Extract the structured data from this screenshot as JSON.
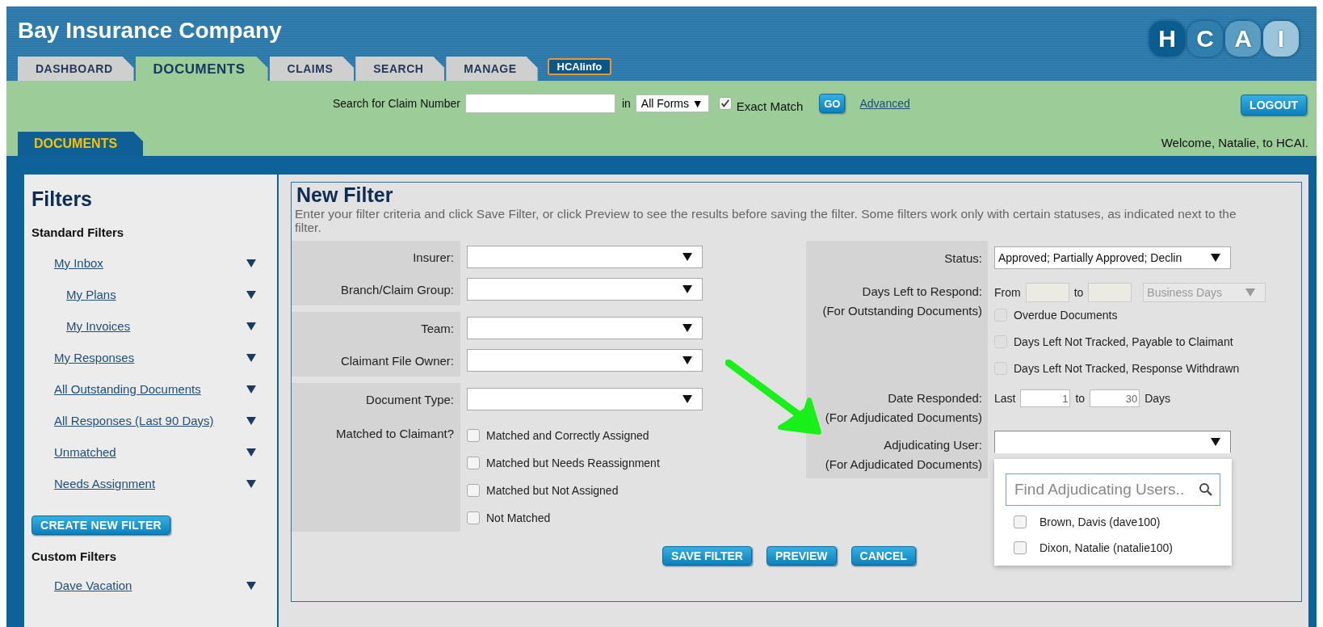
{
  "header": {
    "company": "Bay Insurance Company",
    "logo_letters": [
      "H",
      "C",
      "A",
      "I"
    ]
  },
  "tabs": [
    {
      "label": "DASHBOARD",
      "selected": false
    },
    {
      "label": "DOCUMENTS",
      "selected": true
    },
    {
      "label": "CLAIMS",
      "selected": false
    },
    {
      "label": "SEARCH",
      "selected": false
    },
    {
      "label": "MANAGE",
      "selected": false
    }
  ],
  "info_button": "HCAIinfo",
  "search": {
    "label": "Search for Claim Number",
    "in_label": "in",
    "scope": "All Forms",
    "scope_caret": "▼",
    "exact_match": {
      "label": "Exact Match",
      "checked": true
    },
    "go": "GO",
    "advanced": "Advanced"
  },
  "logout": "LOGOUT",
  "section_tab": "DOCUMENTS",
  "welcome": "Welcome, Natalie, to HCAI.",
  "sidebar": {
    "title": "Filters",
    "standard": {
      "heading": "Standard Filters",
      "items": [
        {
          "label": "My Inbox",
          "children": [
            {
              "label": "My Plans"
            },
            {
              "label": "My Invoices"
            }
          ]
        },
        {
          "label": "My Responses"
        },
        {
          "label": "All Outstanding Documents"
        },
        {
          "label": "All Responses (Last 90 Days)"
        },
        {
          "label": "Unmatched"
        },
        {
          "label": "Needs Assignment"
        }
      ]
    },
    "create_button": "CREATE NEW FILTER",
    "custom": {
      "heading": "Custom Filters",
      "items": [
        {
          "label": "Dave Vacation"
        }
      ]
    }
  },
  "new_filter": {
    "title": "New Filter",
    "description": "Enter your filter criteria and click Save Filter, or click Preview to see the results before saving the filter. Some filters work only with certain statuses, as indicated next to the filter.",
    "left_groups": [
      {
        "fields": [
          {
            "kind": "select",
            "label": "Insurer:"
          },
          {
            "kind": "select",
            "label": "Branch/Claim Group:"
          }
        ]
      },
      {
        "fields": [
          {
            "kind": "select",
            "label": "Team:"
          },
          {
            "kind": "select",
            "label": "Claimant File Owner:"
          }
        ]
      },
      {
        "fields": [
          {
            "kind": "select",
            "label": "Document Type:"
          },
          {
            "kind": "checkboxes",
            "label": "Matched to Claimant?",
            "options": [
              {
                "label": "Matched and Correctly Assigned",
                "checked": false
              },
              {
                "label": "Matched but Needs Reassignment",
                "checked": false
              },
              {
                "label": "Matched but Not Assigned",
                "checked": false
              },
              {
                "label": "Not Matched",
                "checked": false
              }
            ]
          }
        ]
      }
    ],
    "status": {
      "label": "Status:",
      "value": "Approved; Partially Approved; Declin"
    },
    "days_left": {
      "label": "Days Left to Respond:",
      "note": "(For Outstanding Documents)",
      "from_label": "From",
      "to_label": "to",
      "unit": "Business Days",
      "disabled": true,
      "options": [
        {
          "label": "Overdue Documents",
          "checked": false
        },
        {
          "label": "Days Left Not Tracked, Payable to Claimant",
          "checked": false
        },
        {
          "label": "Days Left Not Tracked, Response Withdrawn",
          "checked": false
        }
      ]
    },
    "date_responded": {
      "label": "Date Responded:",
      "note": "(For Adjudicated Documents)",
      "last_label": "Last",
      "from": "1",
      "to_label": "to",
      "to": "30",
      "unit": "Days"
    },
    "adjudicating_user": {
      "label": "Adjudicating User:",
      "note": "(For Adjudicated Documents)",
      "expanded": true,
      "search_placeholder": "Find Adjudicating Users..",
      "users": [
        {
          "label": "Brown, Davis (dave100)",
          "checked": false
        },
        {
          "label": "Dixon, Natalie (natalie100)",
          "checked": false
        }
      ]
    },
    "buttons": [
      "SAVE FILTER",
      "PREVIEW",
      "CANCEL"
    ]
  }
}
